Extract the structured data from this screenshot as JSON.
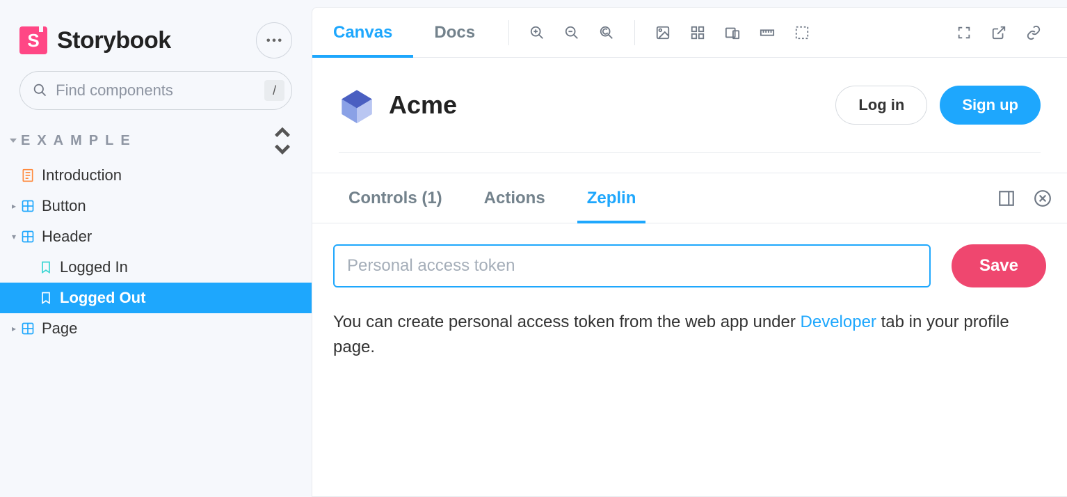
{
  "sidebar": {
    "brand": "Storybook",
    "search_placeholder": "Find components",
    "shortcut_key": "/",
    "category": "Example",
    "items": {
      "introduction": "Introduction",
      "button": "Button",
      "header": "Header",
      "logged_in": "Logged In",
      "logged_out": "Logged Out",
      "page": "Page"
    }
  },
  "toolbar": {
    "tabs": {
      "canvas": "Canvas",
      "docs": "Docs"
    }
  },
  "preview": {
    "title": "Acme",
    "login_label": "Log in",
    "signup_label": "Sign up"
  },
  "addons": {
    "tabs": {
      "controls": "Controls (1)",
      "actions": "Actions",
      "zeplin": "Zeplin"
    },
    "zeplin": {
      "token_placeholder": "Personal access token",
      "save_label": "Save",
      "help_before": "You can create personal access token from the web app under ",
      "help_link": "Developer",
      "help_after": " tab in your profile page."
    }
  }
}
